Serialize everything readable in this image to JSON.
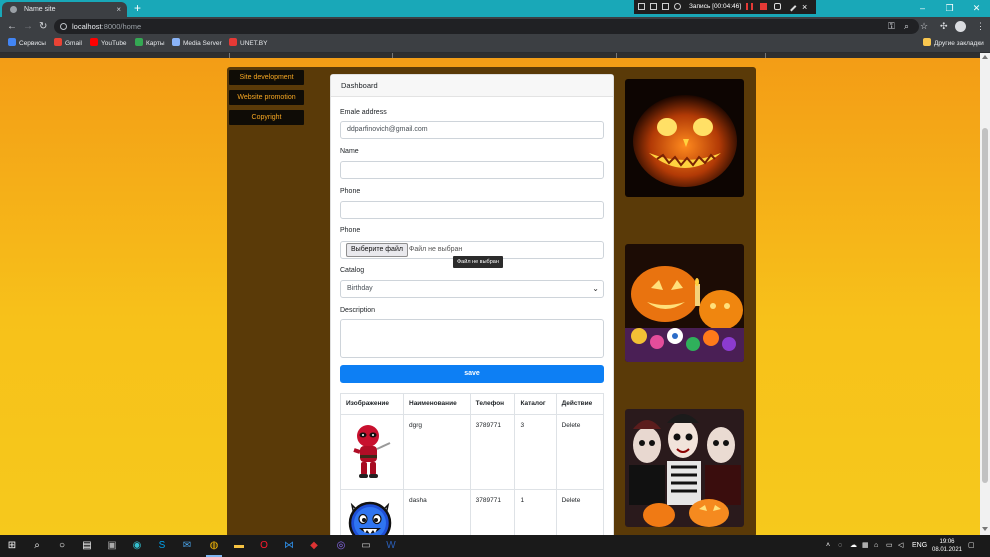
{
  "browser": {
    "tab_title": "Name site",
    "tab_close": "×",
    "new_tab": "+",
    "url_host": "localhost",
    "url_path": ":8000/home",
    "recorder_text": "Запись [00:04:46]",
    "bookmarks": [
      {
        "label": "Сервисы",
        "color": "#4285f4"
      },
      {
        "label": "Gmail",
        "color": "#ea4335"
      },
      {
        "label": "YouTube",
        "color": "#ff0000"
      },
      {
        "label": "Карты",
        "color": "#34a853"
      },
      {
        "label": "Media Server",
        "color": "#8ab4f8"
      },
      {
        "label": "UNET.BY",
        "color": "#e53935"
      }
    ],
    "other_bookmarks": "Другие закладки"
  },
  "sidebar": {
    "items": [
      {
        "label": "Site development"
      },
      {
        "label": "Website promotion"
      },
      {
        "label": "Copyright"
      }
    ]
  },
  "card": {
    "header": "Dashboard",
    "email_label": "Emale address",
    "email_value": "ddparfinovich@gmail.com",
    "name_label": "Name",
    "phone_label": "Phone",
    "file_label": "Phone",
    "file_button": "Выберите файл",
    "file_none": "Файл не выбран",
    "file_tooltip": "Файл не выбран",
    "catalog_label": "Catalog",
    "catalog_value": "Birthday",
    "description_label": "Description",
    "save_label": "save"
  },
  "table": {
    "headers": [
      "Изображение",
      "Наименование",
      "Телефон",
      "Каталог",
      "Действие"
    ],
    "rows": [
      {
        "name": "dgrg",
        "phone": "3789771",
        "catalog": "3",
        "action": "Delete"
      },
      {
        "name": "dasha",
        "phone": "3789771",
        "catalog": "1",
        "action": "Delete"
      }
    ]
  },
  "taskbar": {
    "lang": "ENG",
    "time": "19:06",
    "date": "08.01.2021"
  },
  "colors": {
    "page_gradient_top": "#f39c16",
    "page_gradient_bottom": "#f6c91c",
    "container": "#5a3a08",
    "menu_text": "#f5a623",
    "save_button": "#0d7ff4"
  }
}
